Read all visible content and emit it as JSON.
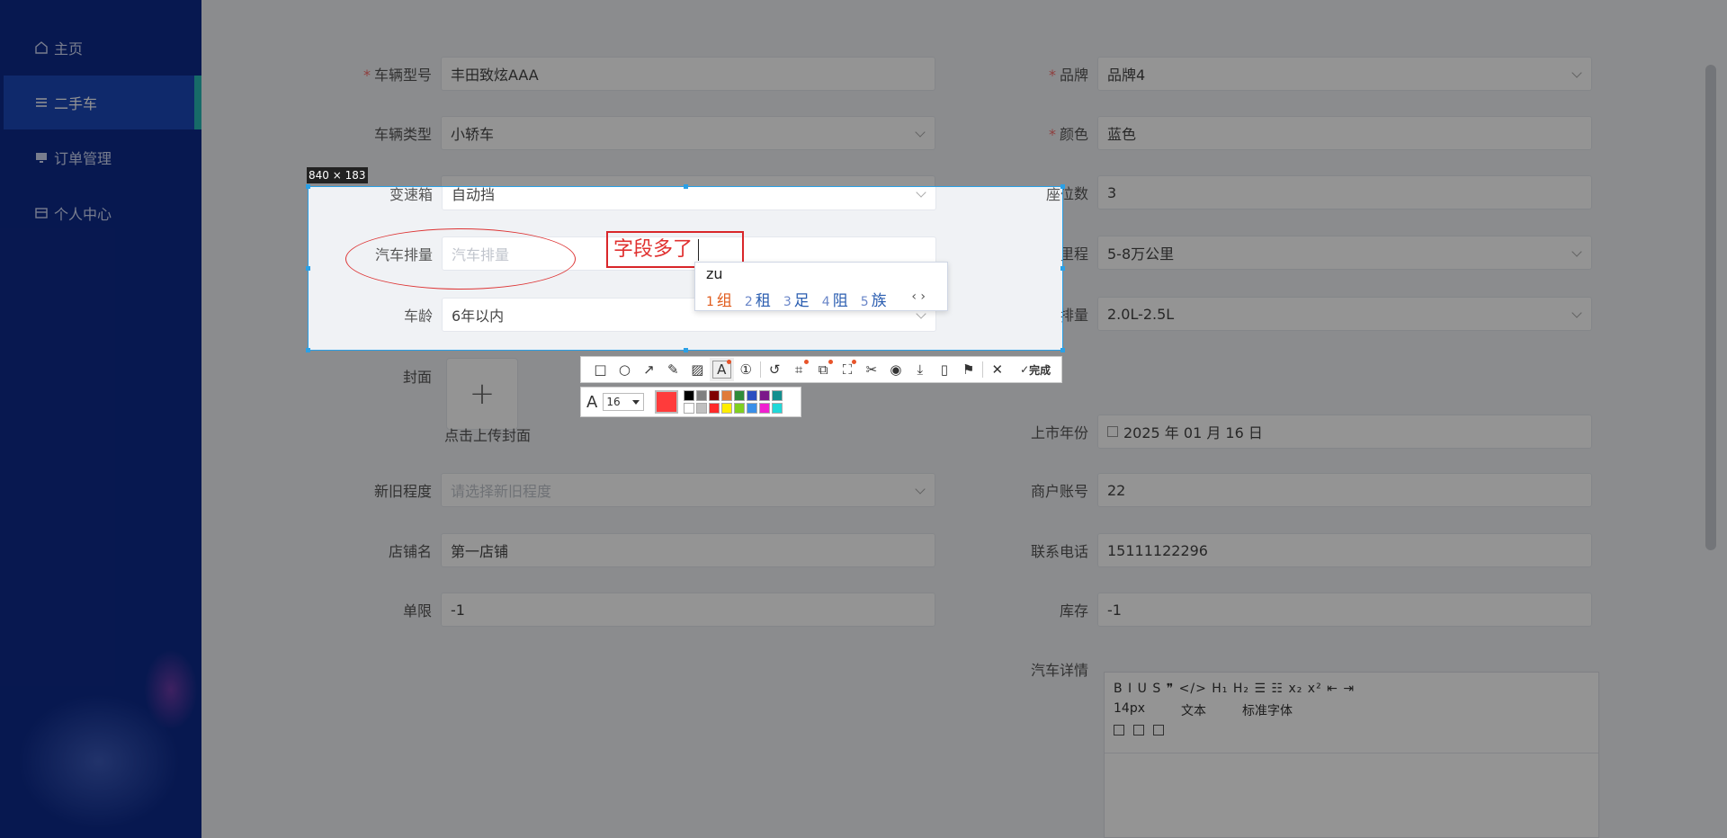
{
  "sidebar": {
    "items": [
      {
        "label": "主页",
        "icon": "home-icon"
      },
      {
        "label": "二手车",
        "icon": "list-icon"
      },
      {
        "label": "订单管理",
        "icon": "monitor-icon"
      },
      {
        "label": "个人中心",
        "icon": "card-icon"
      }
    ],
    "accent": "#29b8b4"
  },
  "form": {
    "model_label": "车辆型号",
    "model_value": "丰田致炫AAA",
    "brand_label": "品牌",
    "brand_value": "品牌4",
    "type_label": "车辆类型",
    "type_value": "小轿车",
    "color_label": "颜色",
    "color_value": "蓝色",
    "gearbox_label": "变速箱",
    "gearbox_value": "自动挡",
    "seats_label": "座位数",
    "seats_value": "3",
    "displacement_label": "汽车排量",
    "displacement_placeholder": "汽车排量",
    "mileage_label": "里程",
    "mileage_value": "5-8万公里",
    "age_label": "车龄",
    "age_value": "6年以内",
    "disp2_label": "排量",
    "disp2_value": "2.0L-2.5L",
    "cover_label": "封面",
    "cover_hint": "点击上传封面",
    "year_label": "上市年份",
    "year_value": "2025 年 01 月 16 日",
    "condition_label": "新旧程度",
    "condition_placeholder": "请选择新旧程度",
    "merchant_label": "商户账号",
    "merchant_value": "22",
    "shop_label": "店铺名",
    "shop_value": "第一店铺",
    "phone_label": "联系电话",
    "phone_value": "15111122296",
    "limit_label": "单限",
    "limit_value": "-1",
    "stock_label": "库存",
    "stock_value": "-1",
    "detail_label": "汽车详情"
  },
  "editor": {
    "row1": "B  I  U  S   ❞  </>   H₁  H₂   ☰  ☷   x₂  x²   ⇤  ⇥",
    "font_size": "14px",
    "text_type": "文本",
    "font_family": "标准字体"
  },
  "screenshot": {
    "size_badge": "840 × 183",
    "annotation_text": "字段多了",
    "ime_composition": "zu",
    "ime_candidates": [
      {
        "n": "1",
        "text": "组"
      },
      {
        "n": "2",
        "text": "租"
      },
      {
        "n": "3",
        "text": "足"
      },
      {
        "n": "4",
        "text": "阻"
      },
      {
        "n": "5",
        "text": "族"
      }
    ],
    "done_label": "完成",
    "font_size": "16",
    "current_color": "#ff3b3b",
    "palette": [
      "#000000",
      "#808080",
      "#800000",
      "#e07b39",
      "#2e8b3a",
      "#2a4fc0",
      "#7b1a8a",
      "#138f8f",
      "#ffffff",
      "#c0c0c0",
      "#ff2a2a",
      "#ffee00",
      "#80d020",
      "#3a8fe8",
      "#f020d0",
      "#20d8d8"
    ]
  }
}
